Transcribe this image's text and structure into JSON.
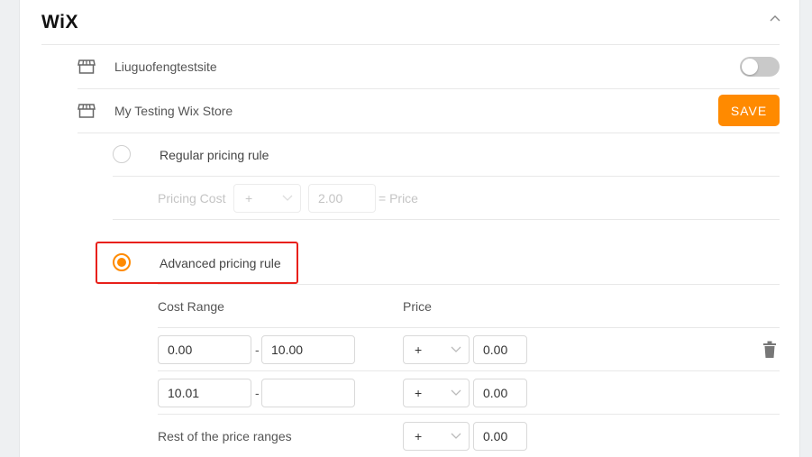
{
  "header": {
    "logo": "WiX",
    "collapse_icon": "chevron-up-icon"
  },
  "stores": [
    {
      "name": "Liuguofengtestsite",
      "icon": "store-icon",
      "toggle_on": false
    },
    {
      "name": "My Testing Wix Store",
      "icon": "store-icon",
      "save_label": "SAVE"
    }
  ],
  "regular_rule": {
    "label": "Regular pricing rule",
    "selected": false,
    "pricing_cost_label": "Pricing Cost",
    "operator": "+",
    "value": "2.00",
    "result_label": "= Price"
  },
  "advanced_rule": {
    "label": "Advanced pricing rule",
    "selected": true,
    "cost_range_header": "Cost Range",
    "price_header": "Price",
    "separator": "-",
    "ranges": [
      {
        "from": "0.00",
        "to": "10.00",
        "operator": "+",
        "price": "0.00",
        "deletable": true
      },
      {
        "from": "10.01",
        "to": "",
        "operator": "+",
        "price": "0.00",
        "deletable": false
      }
    ],
    "rest": {
      "label": "Rest of the price ranges",
      "operator": "+",
      "price": "0.00"
    }
  },
  "colors": {
    "accent": "#ff8a00",
    "highlight": "#e8201a"
  }
}
